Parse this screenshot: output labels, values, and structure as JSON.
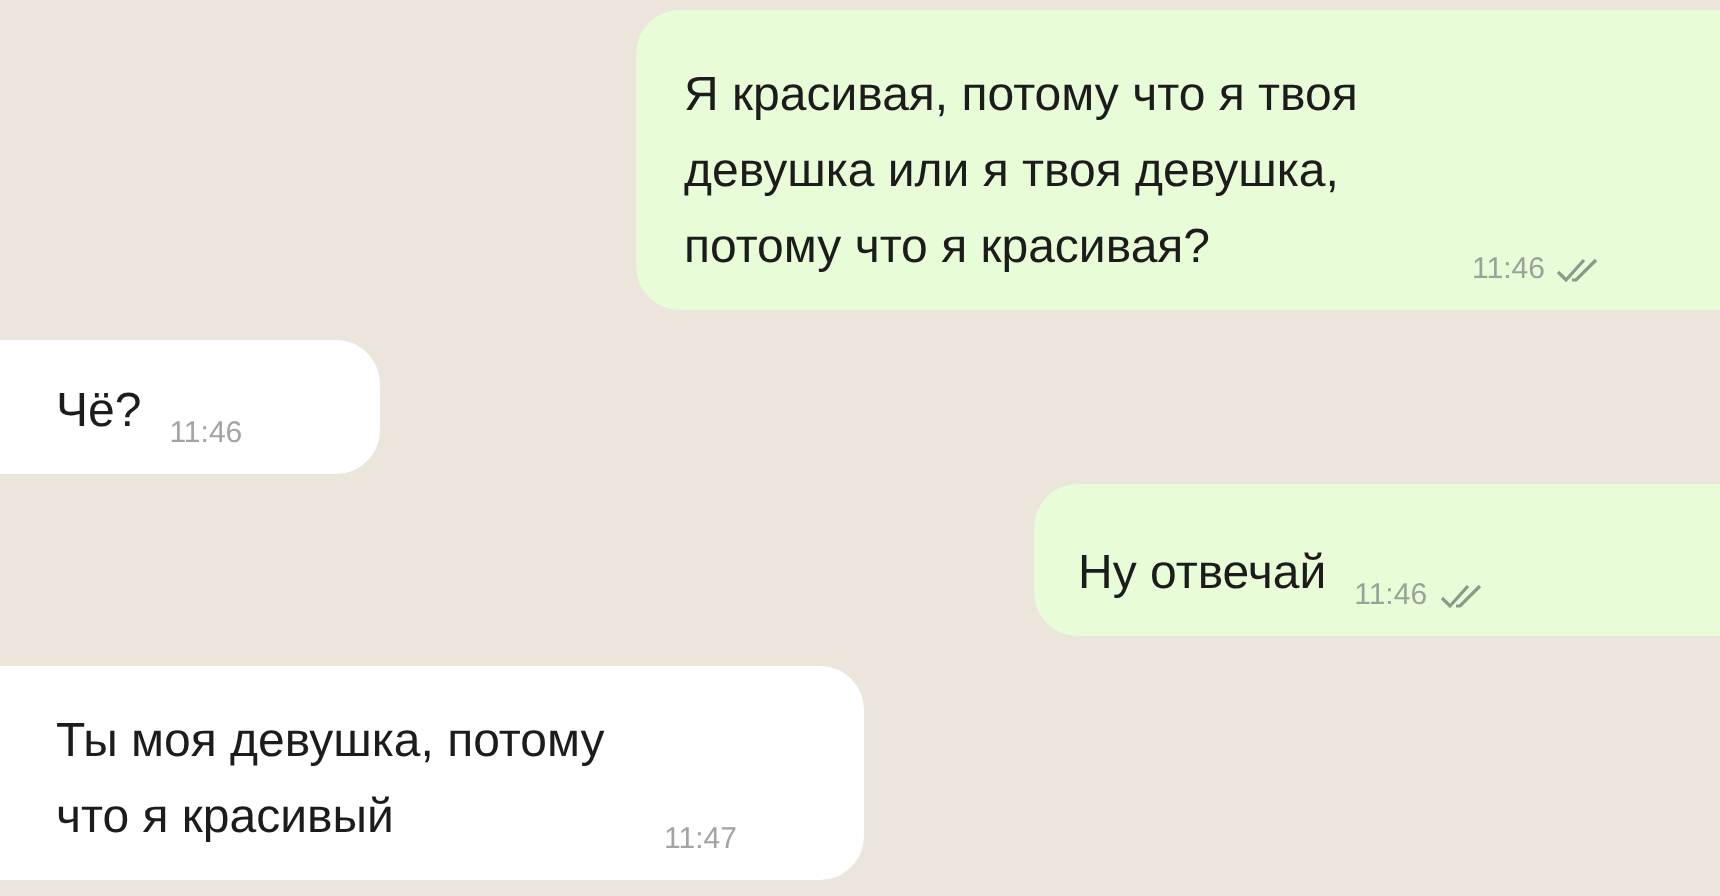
{
  "messages": [
    {
      "kind": "out",
      "text": "Я красивая, потому что я твоя девушка или я твоя девушка, потому что я красивая?",
      "time": "11:46"
    },
    {
      "kind": "in",
      "text": "Чё?",
      "time": "11:46"
    },
    {
      "kind": "out",
      "text": "Ну отвечай",
      "time": "11:46"
    },
    {
      "kind": "in",
      "text": "Ты моя девушка, потому что я красивый",
      "time": "11:47"
    }
  ]
}
